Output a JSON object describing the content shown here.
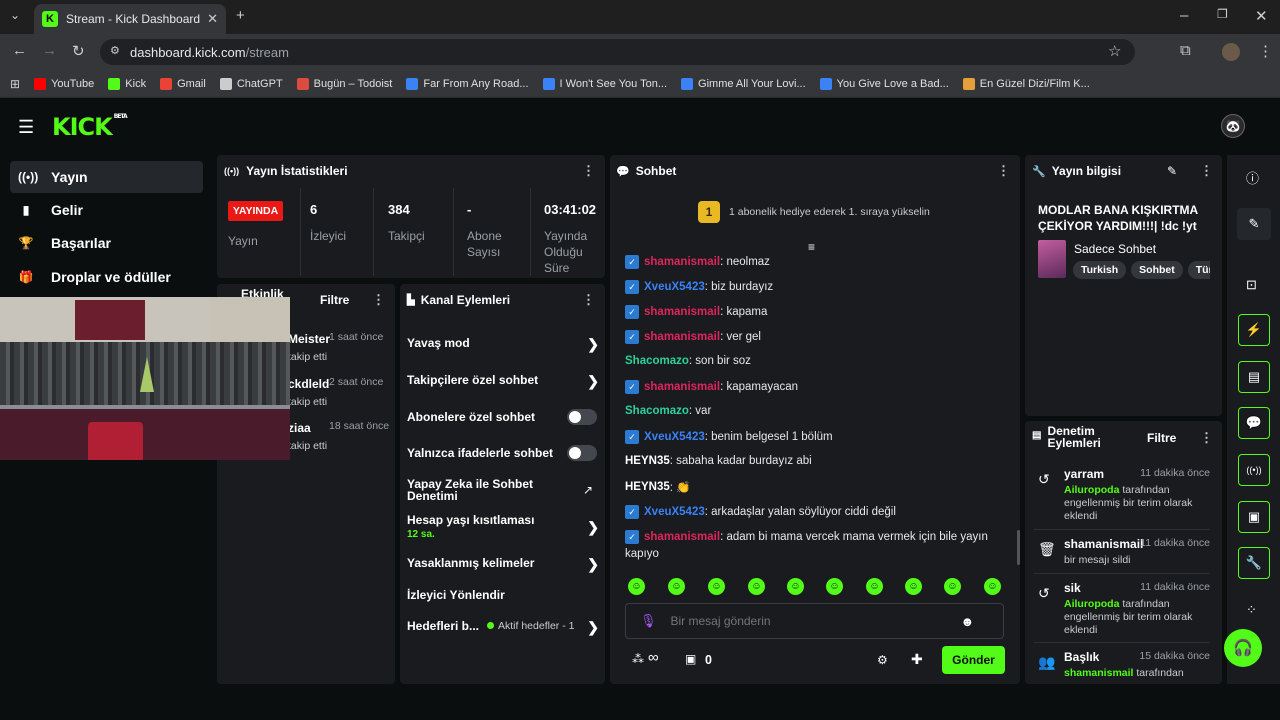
{
  "browser": {
    "tab_title": "Stream - Kick Dashboard",
    "url_host": "dashboard.kick.com",
    "url_path": "/stream",
    "bookmarks": [
      {
        "label": "YouTube",
        "color": "#ff0000"
      },
      {
        "label": "Kick",
        "color": "#53fc18"
      },
      {
        "label": "Gmail",
        "color": "#ea4335"
      },
      {
        "label": "ChatGPT",
        "color": "#cccccc"
      },
      {
        "label": "Bugün – Todoist",
        "color": "#db4c3f"
      },
      {
        "label": "Far From Any Road...",
        "color": "#3b82f6"
      },
      {
        "label": "I Won't See You Ton...",
        "color": "#3b82f6"
      },
      {
        "label": "Gimme All Your Lovi...",
        "color": "#3b82f6"
      },
      {
        "label": "You Give Love a Bad...",
        "color": "#3b82f6"
      },
      {
        "label": "En Güzel Dizi/Film K...",
        "color": "#e5a03b"
      }
    ]
  },
  "brand": {
    "logo": "KICK",
    "beta": "BETA"
  },
  "sidebar": {
    "items": [
      {
        "label": "Yayın",
        "icon": "broadcast-icon"
      },
      {
        "label": "Gelir",
        "icon": "chart-icon"
      },
      {
        "label": "Başarılar",
        "icon": "trophy-icon"
      },
      {
        "label": "Droplar ve ödüller",
        "icon": "gift-icon"
      }
    ]
  },
  "stats": {
    "title": "Yayın İstatistikleri",
    "live_badge": "YAYINDA",
    "live_label": "Yayın",
    "viewers_value": "6",
    "viewers_label": "İzleyici",
    "followers_value": "384",
    "followers_label": "Takipçi",
    "subs_value": "-",
    "subs_label": "Abone Sayısı",
    "uptime_value": "03:41:02",
    "uptime_label": "Yayında Olduğu Süre"
  },
  "activity": {
    "title": "Etkinlik",
    "filter": "Filtre",
    "items": [
      {
        "name": "Meister",
        "time": "1 saat önce",
        "action": "takip etti"
      },
      {
        "name": "ckdleld",
        "time": "2 saat önce",
        "action": "takip etti"
      },
      {
        "name": "ziaa",
        "time": "18 saat önce",
        "action": "takip etti"
      }
    ]
  },
  "channel_actions": {
    "title": "Kanal Eylemleri",
    "slow_mode": "Yavaş mod",
    "followers_only": "Takipçilere özel sohbet",
    "subs_only": "Abonelere özel sohbet",
    "emotes_only": "Yalnızca ifadelerle sohbet",
    "ai_moderation": "Yapay Zeka ile Sohbet Denetimi",
    "account_age": "Hesap yaşı kısıtlaması",
    "account_age_value": "12 sa.",
    "banned_words": "Yasaklanmış kelimeler",
    "viewer_redirect": "İzleyici Yönlendir",
    "goals": "Hedefleri b...",
    "goals_status": "Aktif hedefler - 1"
  },
  "chat": {
    "title": "Sohbet",
    "pinned_rank": "1",
    "pinned_text": "1 abonelik hediye ederek 1. sıraya yükselin",
    "messages": [
      {
        "user": "shamanismail",
        "text": ": neolmaz",
        "style": "red",
        "badge": true
      },
      {
        "user": "XveuX5423",
        "text": ": biz burdayız",
        "style": "blue",
        "badge": true
      },
      {
        "user": "shamanismail",
        "text": ": kapama",
        "style": "red",
        "badge": true
      },
      {
        "user": "shamanismail",
        "text": ": ver gel",
        "style": "red",
        "badge": true
      },
      {
        "user": "Shacomazo",
        "text": ": son bir soz",
        "style": "teal",
        "badge": false
      },
      {
        "user": "shamanismail",
        "text": ": kapamayacan",
        "style": "red",
        "badge": true
      },
      {
        "user": "Shacomazo",
        "text": ": var",
        "style": "teal",
        "badge": false
      },
      {
        "user": "XveuX5423",
        "text": ": benim belgesel 1 bölüm",
        "style": "blue",
        "badge": true
      },
      {
        "user": "HEYN35",
        "text": ": sabaha kadar burdayız abi",
        "style": "white",
        "badge": false
      },
      {
        "user": "HEYN35",
        "text": ": 👏",
        "style": "white",
        "badge": false
      },
      {
        "user": "XveuX5423",
        "text": ": arkadaşlar yalan söylüyor ciddi değil",
        "style": "blue",
        "badge": true
      },
      {
        "user": "shamanismail",
        "text": ": adam bi mama vercek mama vermek için bile yayın",
        "style": "red",
        "badge": true
      }
    ],
    "last_line_wrap": "kapıyo",
    "input_placeholder": "Bir mesaj gönderin",
    "points": "0",
    "send_label": "Gönder",
    "infinity": "∞"
  },
  "stream_info": {
    "title": "Yayın bilgisi",
    "stream_title": "MODLAR BANA KIŞKIRTMA ÇEKİYOR YARDIM!!!| !dc !yt !ig",
    "category": "Sadece Sohbet",
    "tags": [
      "Turkish",
      "Sohbet",
      "Türk"
    ]
  },
  "mod_actions": {
    "title": "Denetim Eylemleri",
    "filter": "Filtre",
    "items": [
      {
        "name": "yarram",
        "time": "11 dakika önce",
        "actor": "Ailuropoda",
        "desc": " tarafından engellenmiş bir terim olarak eklendi",
        "icon": "undo-icon"
      },
      {
        "name": "shamanismail",
        "time": "11 dakika önce",
        "actor": "",
        "desc": "bir mesajı sildi",
        "icon": "trash-icon"
      },
      {
        "name": "sik",
        "time": "11 dakika önce",
        "actor": "Ailuropoda",
        "desc": " tarafından engellenmiş bir terim olarak eklendi",
        "icon": "undo-icon"
      },
      {
        "name": "Başlık",
        "time": "15 dakika önce",
        "actor": "shamanismail",
        "desc": " tarafından",
        "icon": "users-icon"
      }
    ]
  }
}
